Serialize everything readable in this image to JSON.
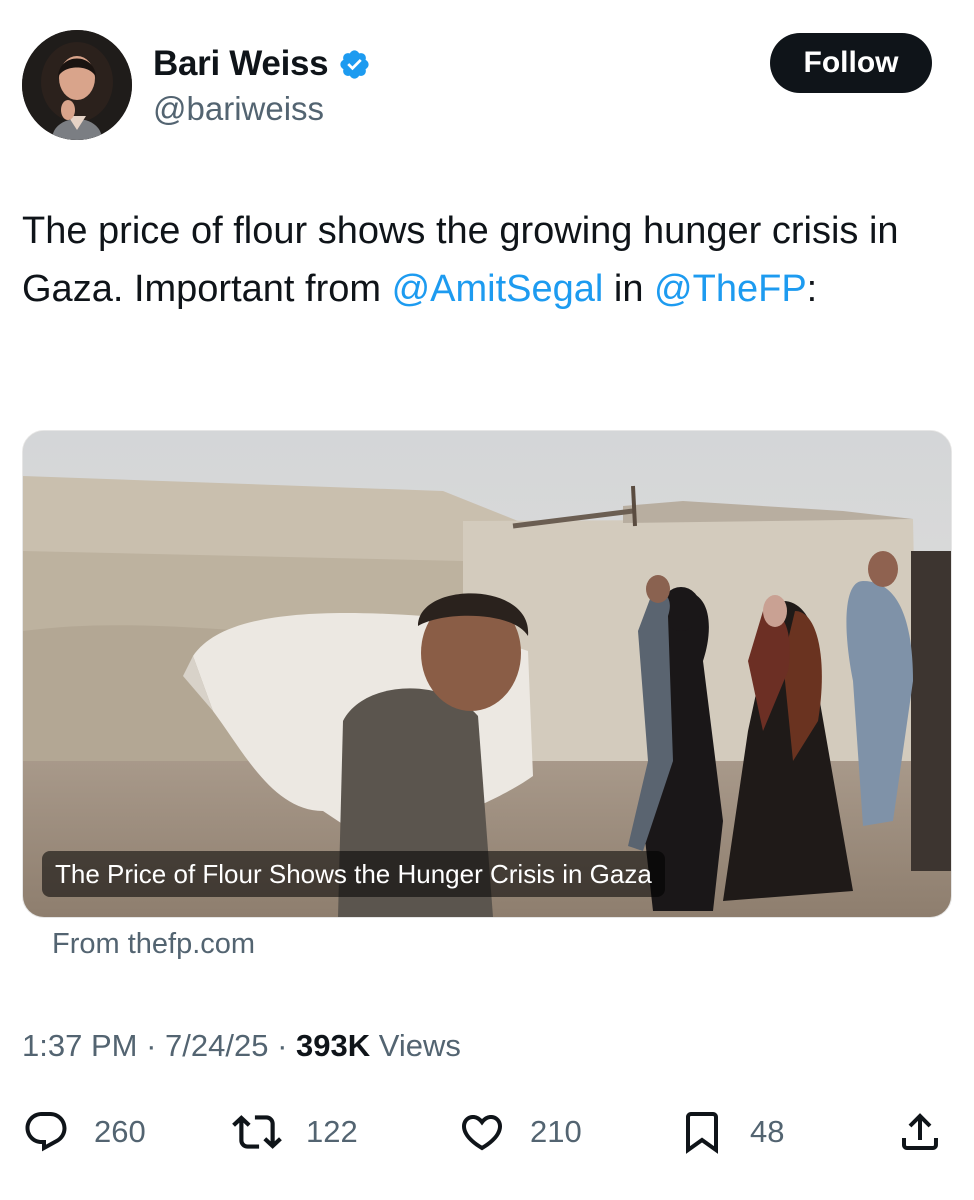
{
  "author": {
    "display_name": "Bari Weiss",
    "handle": "@bariweiss",
    "verified_icon": "verified-badge-icon",
    "avatar_icon": "avatar"
  },
  "follow_label": "Follow",
  "tweet": {
    "text_part1": "The price of flour shows the growing hunger crisis in Gaza. Important from ",
    "mention1": "@AmitSegal",
    "text_part2": " in ",
    "mention2": "@TheFP",
    "text_part3": ":"
  },
  "card": {
    "title": "The Price of Flour Shows the Hunger Crisis in Gaza",
    "source": "From thefp.com"
  },
  "meta": {
    "time": "1:37 PM",
    "sep": "·",
    "date": "7/24/25",
    "views_count": "393K",
    "views_label": "Views"
  },
  "actions": {
    "replies": "260",
    "retweets": "122",
    "likes": "210",
    "bookmarks": "48"
  },
  "colors": {
    "accent": "#1d9bf0",
    "text": "#0f1419",
    "secondary": "#536471",
    "button_bg": "#0f1419"
  }
}
